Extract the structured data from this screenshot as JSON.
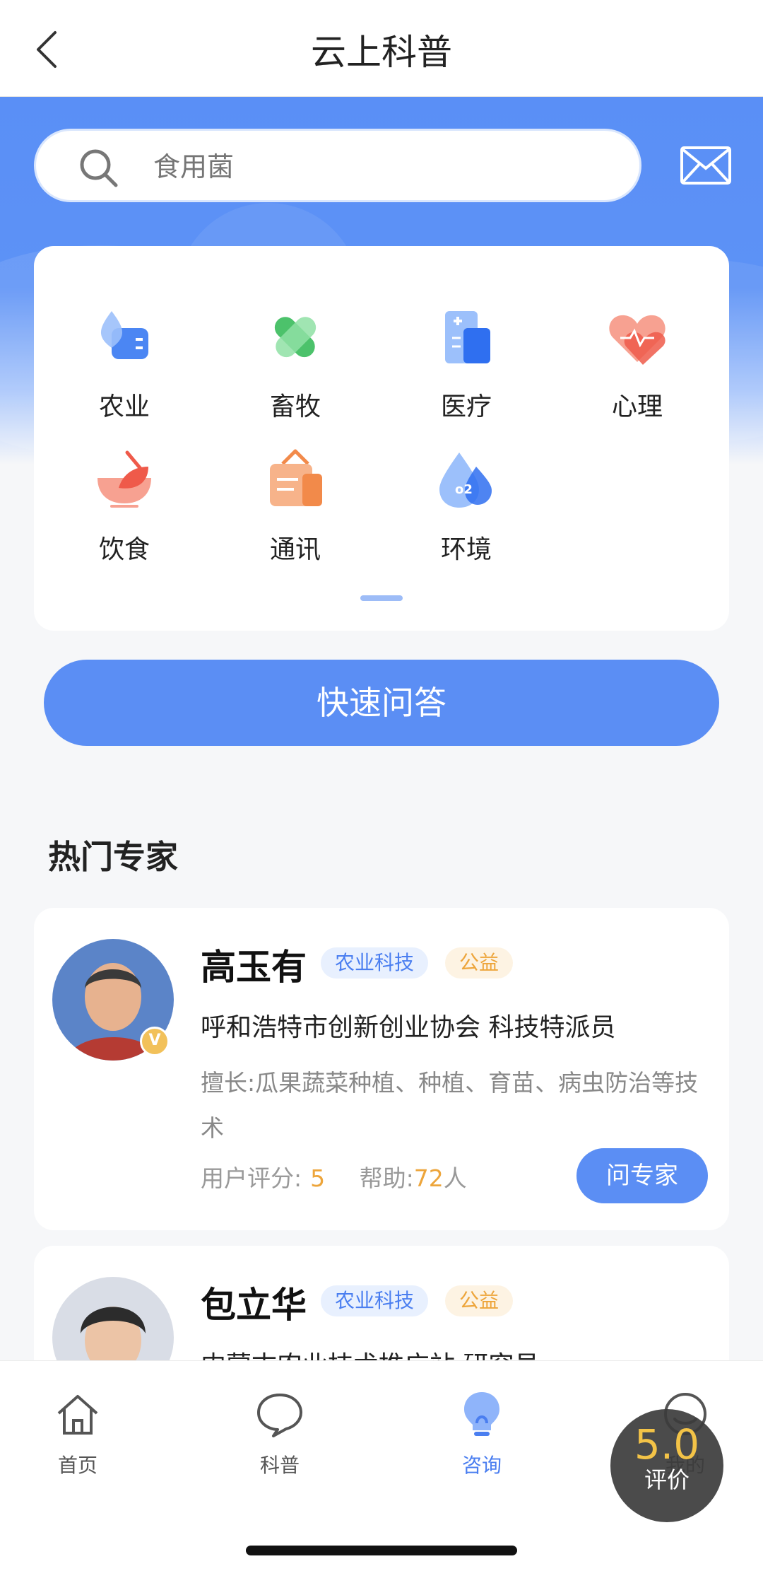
{
  "nav": {
    "title": "云上科普"
  },
  "search": {
    "placeholder": "食用菌"
  },
  "categories": [
    {
      "label": "农业",
      "icon": "agriculture-icon",
      "color": "#4b86f3"
    },
    {
      "label": "畜牧",
      "icon": "livestock-icon",
      "color": "#4cc26b"
    },
    {
      "label": "医疗",
      "icon": "medical-icon",
      "color": "#4b86f3"
    },
    {
      "label": "心理",
      "icon": "psychology-icon",
      "color": "#f06a5a"
    },
    {
      "label": "饮食",
      "icon": "diet-icon",
      "color": "#f07a5a"
    },
    {
      "label": "通讯",
      "icon": "communication-icon",
      "color": "#f28a4a"
    },
    {
      "label": "环境",
      "icon": "environment-icon",
      "color": "#4b86f3"
    }
  ],
  "quick_button": "快速问答",
  "section_title": "热门专家",
  "experts": [
    {
      "name": "高玉有",
      "tags": [
        "农业科技",
        "公益"
      ],
      "org": "呼和浩特市创新创业协会 科技特派员",
      "skill_label": "擅长:",
      "skill": "瓜果蔬菜种植、种植、育苗、病虫防治等技术",
      "rating_label": "用户评分:",
      "rating": "5",
      "help_label": "帮助:",
      "help_count": "72",
      "help_unit": "人",
      "ask_label": "问专家"
    },
    {
      "name": "包立华",
      "tags": [
        "农业科技",
        "公益"
      ],
      "org": "内蒙古农业技术推广站 研究员"
    }
  ],
  "tabs": [
    {
      "label": "首页",
      "icon": "home-icon"
    },
    {
      "label": "科普",
      "icon": "chat-bubble-icon"
    },
    {
      "label": "咨询",
      "icon": "lightbulb-icon",
      "active": true
    },
    {
      "label": "我的",
      "icon": "profile-icon"
    }
  ],
  "rating_badge": {
    "score": "5.0",
    "label": "评价"
  },
  "colors": {
    "primary": "#5b8ef4",
    "accent": "#eda53b",
    "background": "#f6f7f9"
  }
}
